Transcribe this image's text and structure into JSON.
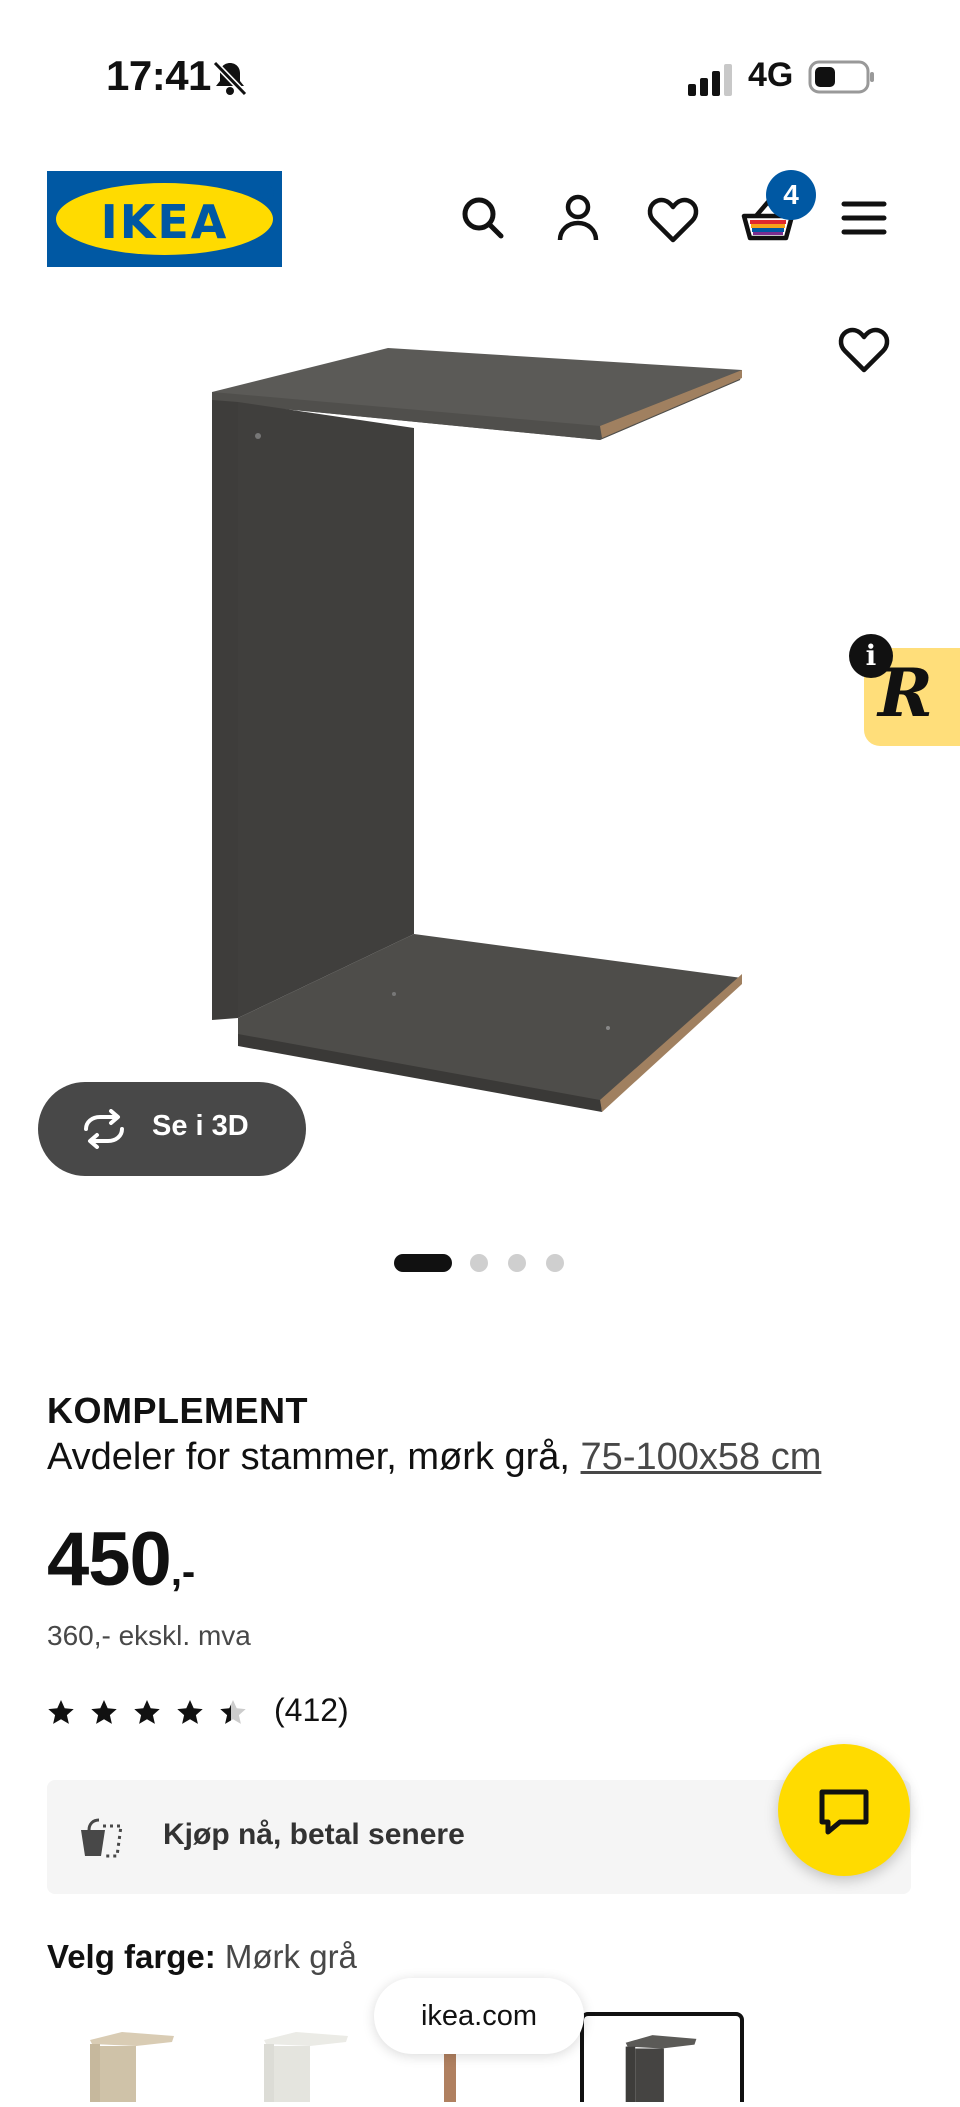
{
  "status_bar": {
    "time": "17:41",
    "network": "4G"
  },
  "header": {
    "logo_text": "IKEA",
    "cart_count": "4"
  },
  "gallery": {
    "view_3d_label": "Se i 3D",
    "slide_count": 4,
    "active_slide": 1
  },
  "product": {
    "name": "KOMPLEMENT",
    "description": "Avdeler for stammer, mørk grå,",
    "size": "75-100x58 cm",
    "price": "450",
    "price_suffix": ",-",
    "price_ex_vat": "360,- ekskl. mva",
    "rating": 4.5,
    "review_count": "(412)"
  },
  "payment": {
    "bnpl_label": "Kjøp nå, betal senere"
  },
  "color": {
    "label": "Velg farge:",
    "value": "Mørk grå"
  },
  "browser": {
    "domain": "ikea.com"
  },
  "colors": {
    "brand_blue": "#0058a3",
    "brand_yellow": "#ffdb00",
    "panel_color": "#4a4846"
  }
}
